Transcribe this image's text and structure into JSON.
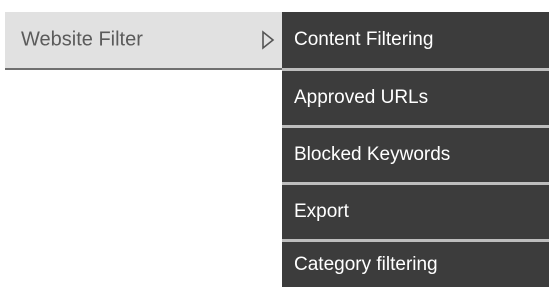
{
  "menu": {
    "parent": {
      "label": "Website Filter",
      "arrow_icon": "chevron-right-outline-icon"
    },
    "submenu": [
      {
        "label": "Content Filtering"
      },
      {
        "label": "Approved URLs"
      },
      {
        "label": "Blocked Keywords"
      },
      {
        "label": "Export"
      },
      {
        "label": "Category filtering"
      }
    ]
  },
  "colors": {
    "parent_bg": "#e1e1e1",
    "parent_text": "#5b5b5b",
    "submenu_bg": "#3c3c3c",
    "submenu_text": "#ffffff",
    "submenu_divider": "#bdbdbd"
  }
}
